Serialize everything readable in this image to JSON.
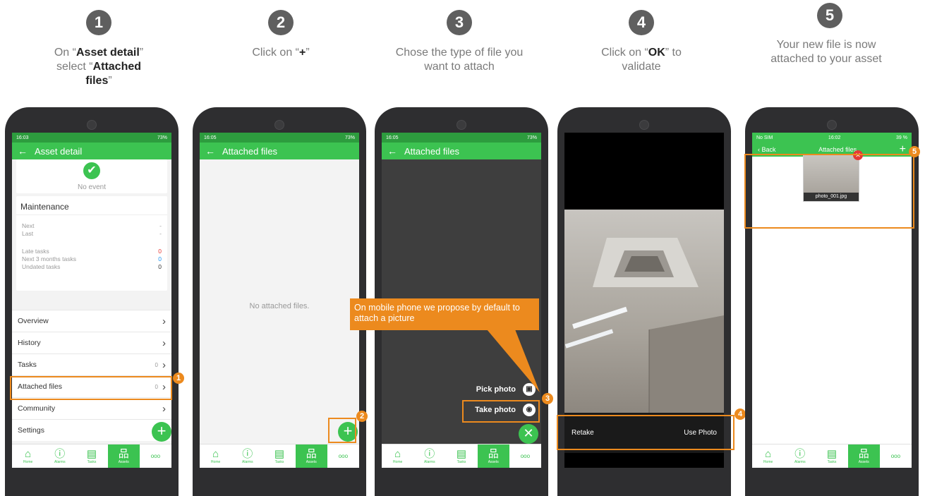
{
  "steps": [
    {
      "num": "1",
      "pre": "On “",
      "b1": "Asset detail",
      "mid": "” select “",
      "b2": "Attached files",
      "post": "”"
    },
    {
      "num": "2",
      "pre": "Click on “",
      "b1": "+",
      "post": "”"
    },
    {
      "num": "3",
      "text": "Chose the type of file you want to attach"
    },
    {
      "num": "4",
      "pre": "Click on  “",
      "b1": "OK",
      "post": "” to validate"
    },
    {
      "num": "5",
      "text": "Your new file is now attached to your asset"
    }
  ],
  "phone1": {
    "status_time": "16:03",
    "status_right": "73%",
    "title": "Asset detail",
    "no_event": "No event",
    "maintenance": "Maintenance",
    "next_label": "Next",
    "next_value": "-",
    "last_label": "Last",
    "last_value": "-",
    "late_label": "Late tasks",
    "late_value": "0",
    "next3_label": "Next 3 months tasks",
    "next3_value": "0",
    "undated_label": "Undated tasks",
    "undated_value": "0",
    "menu": [
      {
        "label": "Overview",
        "count": ""
      },
      {
        "label": "History",
        "count": ""
      },
      {
        "label": "Tasks",
        "count": "0"
      },
      {
        "label": "Attached files",
        "count": "0"
      },
      {
        "label": "Community",
        "count": ""
      },
      {
        "label": "Settings",
        "count": ""
      }
    ]
  },
  "phone2": {
    "status_time": "16:05",
    "status_right": "73%",
    "title": "Attached files",
    "empty": "No attached files."
  },
  "phone3": {
    "status_time": "16:05",
    "status_right": "73%",
    "title": "Attached files",
    "pick": "Pick photo",
    "take": "Take photo"
  },
  "callout": "On mobile phone we propose by default to attach a picture",
  "phone4": {
    "retake": "Retake",
    "use": "Use Photo"
  },
  "phone5": {
    "status_left": "No SIM",
    "status_time": "16:02",
    "status_right": "39 %",
    "back": "Back",
    "title": "Attached files",
    "file": "photo_001.jpg"
  },
  "nav": [
    "Home",
    "Alarms",
    "Tasks",
    "Assets",
    "ooo"
  ],
  "badges": [
    "1",
    "2",
    "3",
    "4",
    "5"
  ],
  "colors": {
    "green": "#3cc351",
    "orange": "#ec8a1e",
    "step_circle": "#5f5f5f"
  }
}
